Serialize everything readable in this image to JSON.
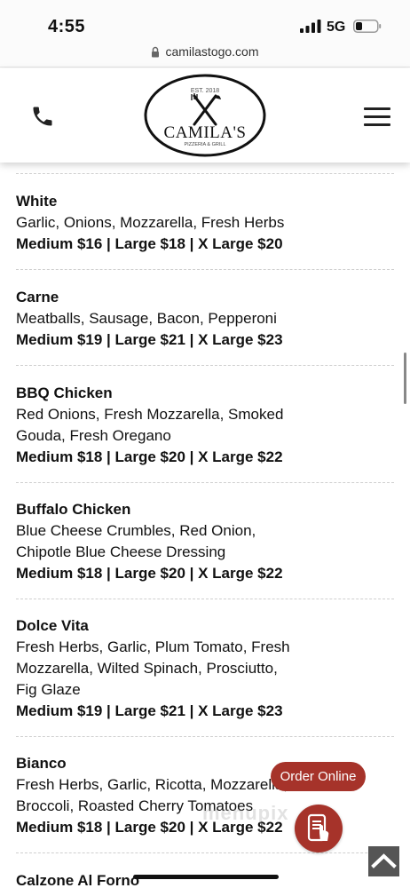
{
  "status_bar": {
    "time": "4:55",
    "network": "5G"
  },
  "browser": {
    "url": "camilastogo.com"
  },
  "header": {
    "logo": {
      "est": "EST. 2018",
      "name": "CAMILA'S",
      "tagline": "PIZZERIA & GRILL"
    }
  },
  "menu": {
    "items": [
      {
        "name": "White",
        "desc": [
          "Garlic, Onions, Mozzarella, Fresh Herbs"
        ],
        "price": "Medium $16 | Large $18 | X Large $20"
      },
      {
        "name": "Carne",
        "desc": [
          "Meatballs, Sausage, Bacon, Pepperoni"
        ],
        "price": "Medium $19 | Large $21 | X Large $23"
      },
      {
        "name": "BBQ Chicken",
        "desc": [
          "Red Onions, Fresh Mozzarella, Smoked",
          "Gouda, Fresh Oregano"
        ],
        "price": "Medium $18 | Large $20 | X Large $22"
      },
      {
        "name": "Buffalo Chicken",
        "desc": [
          "Blue Cheese Crumbles, Red Onion,",
          "Chipotle Blue Cheese Dressing"
        ],
        "price": "Medium $18 | Large $20 | X Large $22"
      },
      {
        "name": "Dolce Vita",
        "desc": [
          "Fresh Herbs, Garlic, Plum Tomato, Fresh",
          "Mozzarella, Wilted Spinach, Prosciutto,",
          "Fig Glaze"
        ],
        "price": "Medium $19 | Large $21 | X Large $23"
      },
      {
        "name": "Bianco",
        "desc": [
          "Fresh Herbs, Garlic, Ricotta, Mozzarella,",
          "Broccoli, Roasted Cherry Tomatoes"
        ],
        "price": "Medium $18 | Large $20 | X Large $22"
      },
      {
        "name": "Calzone Al Forno",
        "desc": [],
        "price": ""
      }
    ]
  },
  "floating": {
    "order_online": "Order Online",
    "watermark": "menupix"
  },
  "colors": {
    "accent": "#a6332a",
    "back_to_top": "#555555"
  },
  "icons": [
    "lock-icon",
    "phone-icon",
    "hamburger-menu-icon",
    "order-app-icon",
    "chevron-up-icon"
  ]
}
